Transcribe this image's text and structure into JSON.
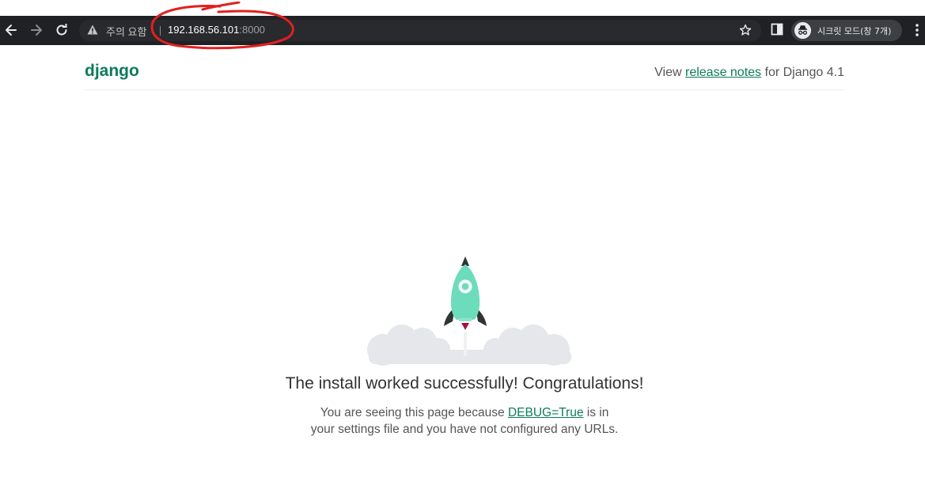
{
  "browser": {
    "security_warning": "주의 요함",
    "url_host": "192.168.56.101",
    "url_port": ":8000",
    "incognito_label": "시크릿 모드(창 7개)"
  },
  "page": {
    "logo": "django",
    "release_prefix": "View ",
    "release_link": "release notes",
    "release_suffix": " for Django 4.1",
    "headline": "The install worked successfully! Congratulations!",
    "desc_prefix": "You are seeing this page because ",
    "desc_link": "DEBUG=True",
    "desc_suffix_1": " is in",
    "desc_line2": "your settings file and you have not configured any URLs."
  },
  "colors": {
    "django_green": "#0c7c59",
    "rocket_body": "#6DDCBD",
    "annotation_red": "#e02020"
  }
}
